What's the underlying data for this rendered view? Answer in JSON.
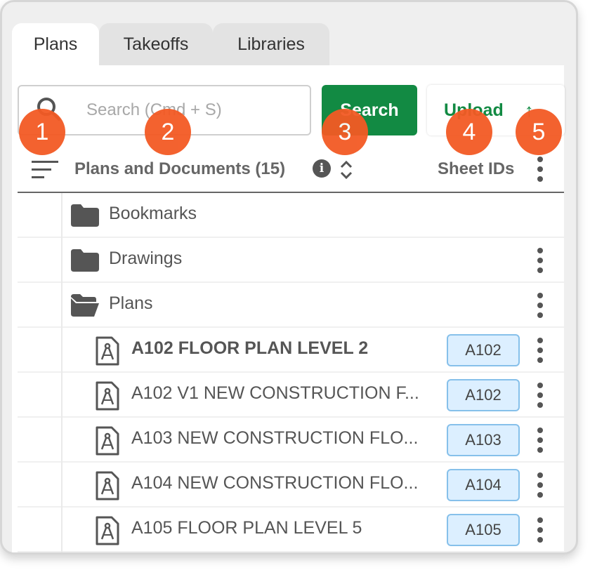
{
  "tabs": [
    {
      "label": "Plans",
      "active": true
    },
    {
      "label": "Takeoffs",
      "active": false
    },
    {
      "label": "Libraries",
      "active": false
    }
  ],
  "search": {
    "placeholder": "Search (Cmd + S)",
    "value": ""
  },
  "buttons": {
    "search_label": "Search",
    "upload_label": "Upload",
    "upload_icon": "arrow-up-icon"
  },
  "header": {
    "title": "Plans and Documents (15)",
    "sheet_ids_label": "Sheet IDs",
    "info_glyph": "i"
  },
  "folders": [
    {
      "label": "Bookmarks",
      "icon": "folder-icon",
      "has_menu": false
    },
    {
      "label": "Drawings",
      "icon": "folder-icon",
      "has_menu": true
    },
    {
      "label": "Plans",
      "icon": "folder-open-icon",
      "has_menu": true
    }
  ],
  "sheets": [
    {
      "label": "A102 FLOOR PLAN LEVEL 2",
      "sheet_id": "A102",
      "bold": true
    },
    {
      "label": "A102 V1 NEW CONSTRUCTION F...",
      "sheet_id": "A102",
      "bold": false
    },
    {
      "label": "A103 NEW CONSTRUCTION FLO...",
      "sheet_id": "A103",
      "bold": false
    },
    {
      "label": "A104 NEW CONSTRUCTION FLO...",
      "sheet_id": "A104",
      "bold": false
    },
    {
      "label": "A105 FLOOR PLAN LEVEL 5",
      "sheet_id": "A105",
      "bold": false
    }
  ],
  "callouts": [
    "1",
    "2",
    "3",
    "4",
    "5"
  ],
  "colors": {
    "accent": "#128a43",
    "callout": "#f35a24",
    "badge_bg": "#dcefff",
    "badge_border": "#86c0ea"
  }
}
